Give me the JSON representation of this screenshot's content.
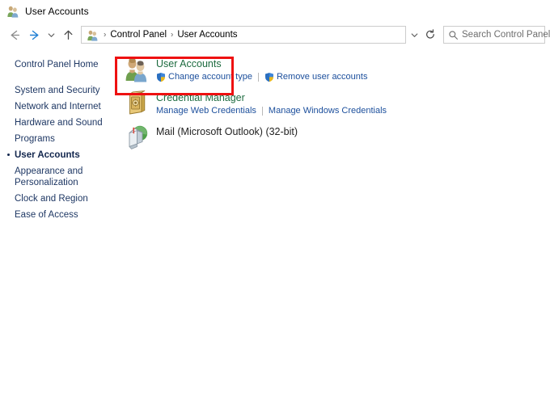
{
  "window": {
    "title": "User Accounts",
    "title_icon": "user-accounts-icon"
  },
  "navigation": {
    "back_icon": "back-arrow-icon",
    "forward_icon": "forward-arrow-icon",
    "recent_icon": "chevron-down-icon",
    "up_icon": "up-arrow-icon",
    "address": {
      "icon": "user-accounts-icon",
      "separator": "›",
      "crumbs": [
        "Control Panel",
        "User Accounts"
      ],
      "dropdown_icon": "chevron-down-icon",
      "refresh_icon": "refresh-icon"
    },
    "search": {
      "icon": "search-icon",
      "placeholder": "Search Control Panel",
      "value": ""
    }
  },
  "sidebar": {
    "home_label": "Control Panel Home",
    "items": [
      {
        "label": "System and Security",
        "current": false
      },
      {
        "label": "Network and Internet",
        "current": false
      },
      {
        "label": "Hardware and Sound",
        "current": false
      },
      {
        "label": "Programs",
        "current": false
      },
      {
        "label": "User Accounts",
        "current": true
      },
      {
        "label": "Appearance and Personalization",
        "current": false
      },
      {
        "label": "Clock and Region",
        "current": false
      },
      {
        "label": "Ease of Access",
        "current": false
      }
    ]
  },
  "main": {
    "categories": [
      {
        "title": "User Accounts",
        "icon": "user-accounts-icon",
        "links": [
          {
            "label": "Change account type",
            "shield": true
          },
          {
            "label": "Remove user accounts",
            "shield": true
          }
        ]
      },
      {
        "title": "Credential Manager",
        "icon": "credential-vault-icon",
        "links": [
          {
            "label": "Manage Web Credentials",
            "shield": false
          },
          {
            "label": "Manage Windows Credentials",
            "shield": false
          }
        ]
      },
      {
        "title": "Mail (Microsoft Outlook) (32-bit)",
        "icon": "mail-icon",
        "plain_title": true,
        "links": []
      }
    ]
  },
  "annotation": {
    "highlight_color": "#ee1111",
    "target": "user-accounts-category"
  },
  "colors": {
    "link": "#1c4f9c",
    "category_title": "#1d6b3f",
    "sidebar_link": "#1f3864",
    "highlight": "#ee1111"
  }
}
